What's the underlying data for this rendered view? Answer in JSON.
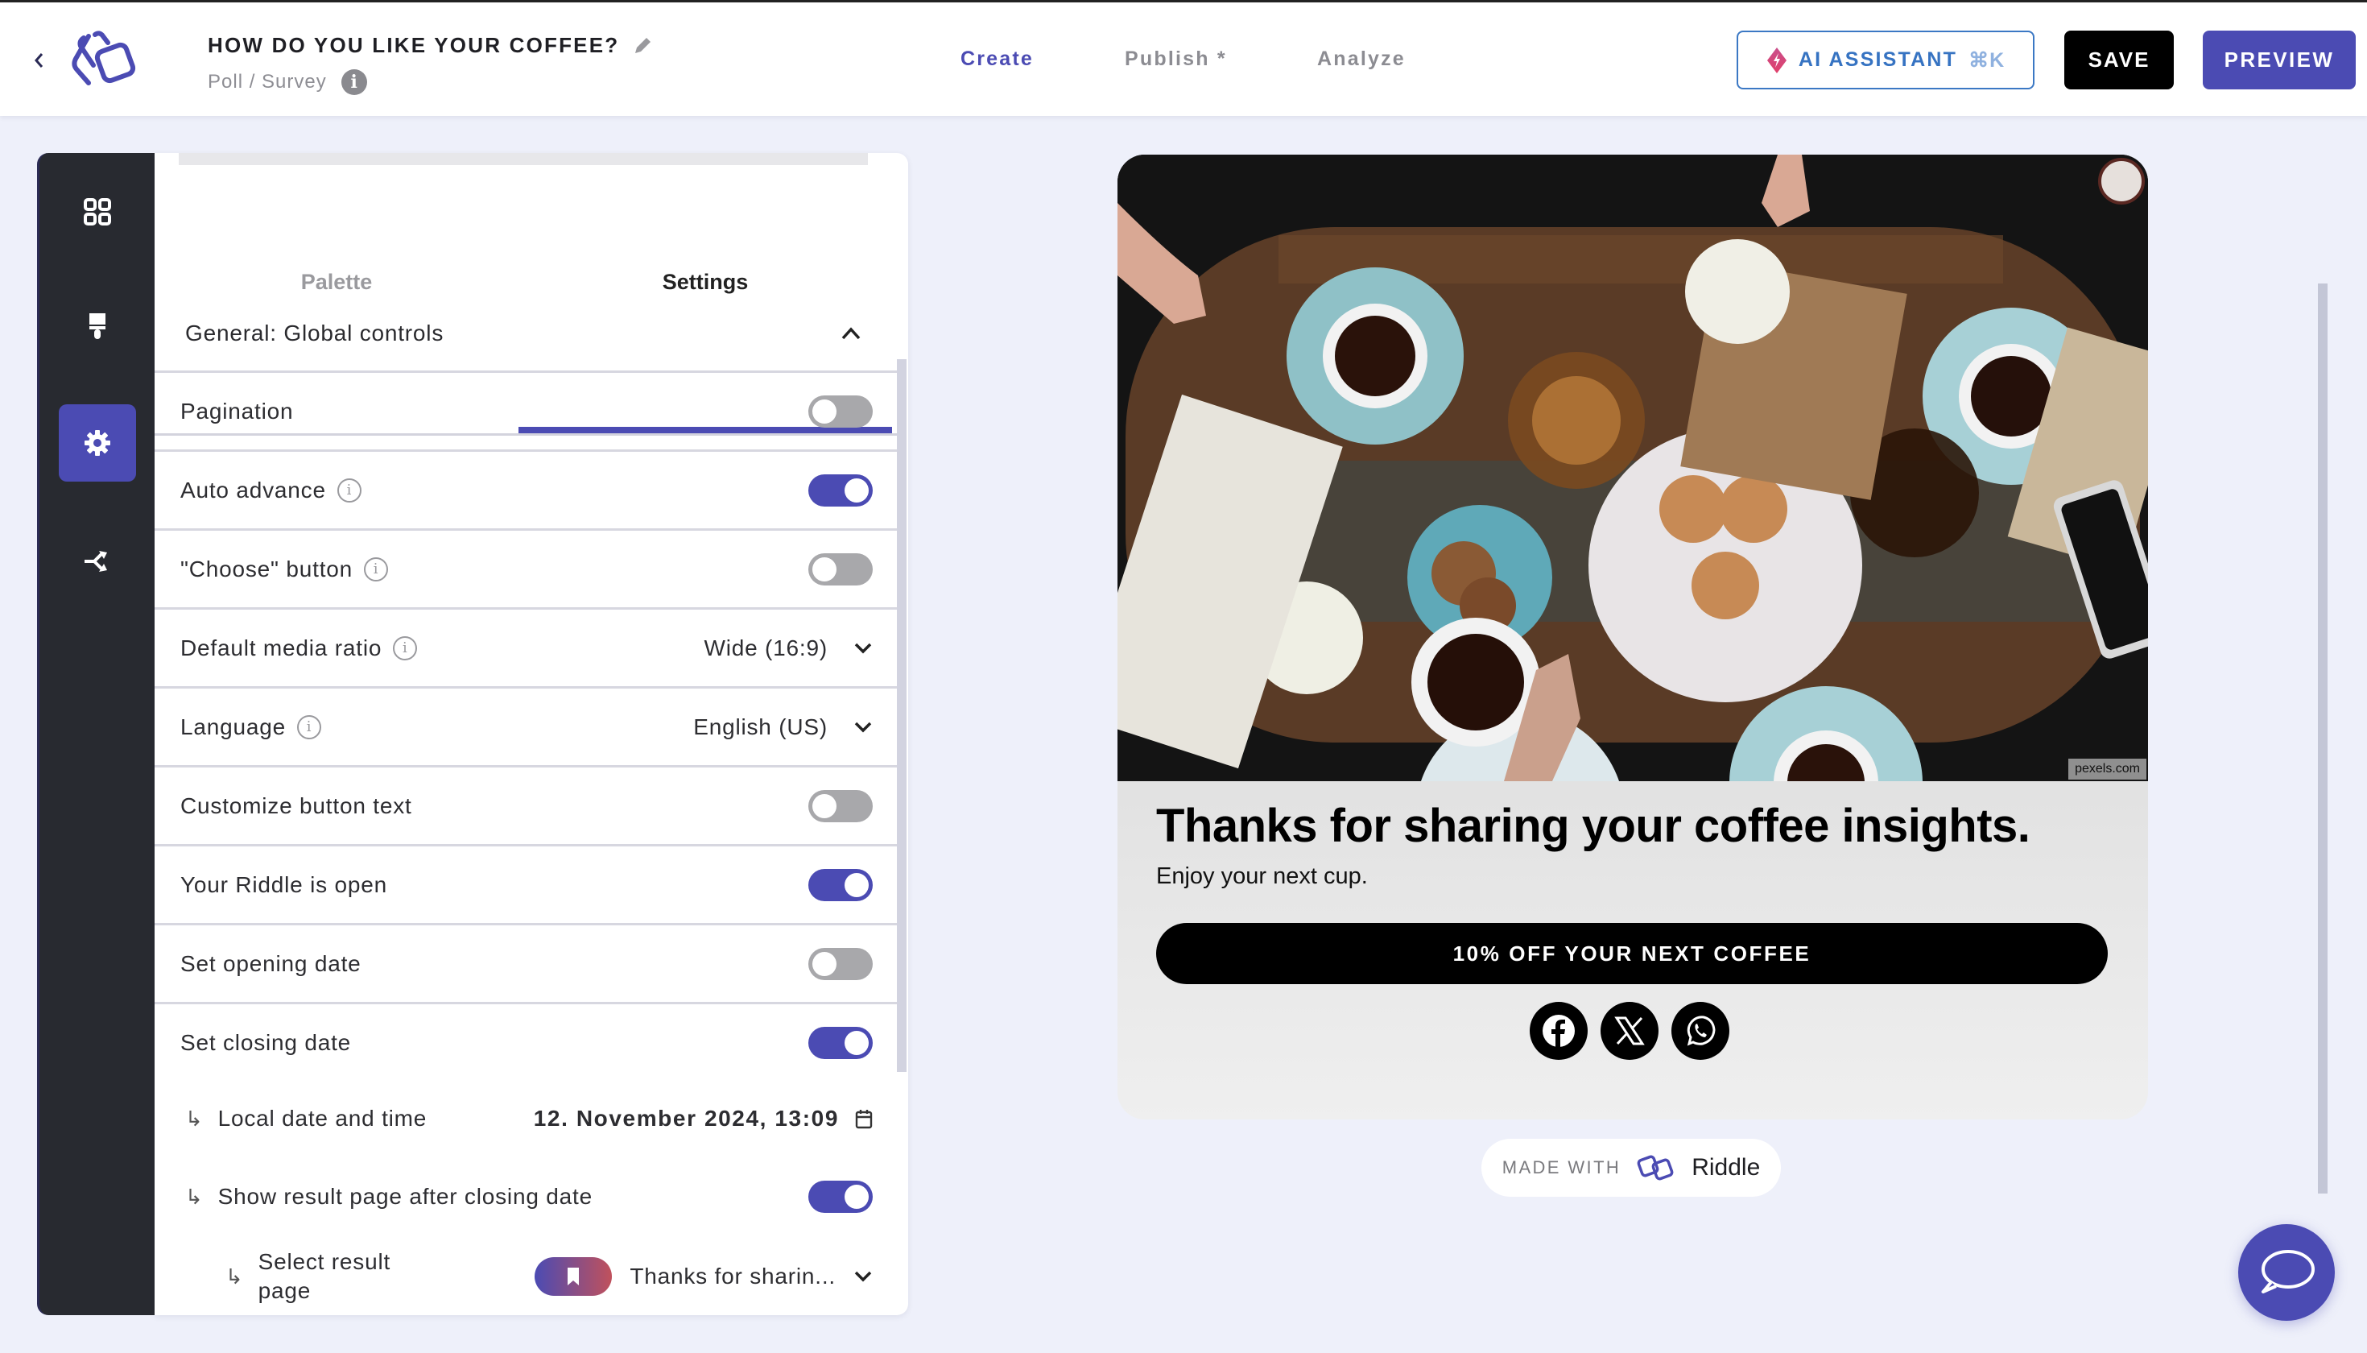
{
  "header": {
    "back_icon": "chevron-left-icon",
    "logo": "riddle-logo",
    "title": "HOW DO YOU LIKE YOUR COFFEE?",
    "edit_icon": "pencil-icon",
    "subtitle": "Poll / Survey",
    "info_icon": "info-icon",
    "nav": [
      {
        "label": "Create",
        "active": true
      },
      {
        "label": "Publish *",
        "active": false
      },
      {
        "label": "Analyze",
        "active": false
      }
    ],
    "ai_assistant": {
      "label": "AI ASSISTANT",
      "shortcut": "⌘K",
      "icon": "sparkle-diamond-icon"
    },
    "save_label": "SAVE",
    "preview_label": "PREVIEW"
  },
  "sidebar": {
    "items": [
      {
        "name": "blocks",
        "icon": "grid-icon",
        "active": false
      },
      {
        "name": "design",
        "icon": "paintbrush-icon",
        "active": false
      },
      {
        "name": "settings",
        "icon": "gear-icon",
        "active": true
      },
      {
        "name": "logic",
        "icon": "branch-icon",
        "active": false
      }
    ]
  },
  "panel": {
    "tabs": [
      {
        "label": "Palette",
        "active": false
      },
      {
        "label": "Settings",
        "active": true
      }
    ],
    "section": {
      "title": "General: Global controls",
      "expanded": true
    },
    "rows": {
      "pagination": {
        "label": "Pagination",
        "on": false
      },
      "auto_advance": {
        "label": "Auto advance",
        "on": true
      },
      "choose_button": {
        "label": "\"Choose\" button",
        "on": false
      },
      "media_ratio": {
        "label": "Default media ratio",
        "value": "Wide (16:9)"
      },
      "language": {
        "label": "Language",
        "value": "English (US)"
      },
      "customize_button_text": {
        "label": "Customize button text",
        "on": false
      },
      "riddle_open": {
        "label": "Your Riddle is open",
        "on": true
      },
      "opening_date": {
        "label": "Set opening date",
        "on": false
      },
      "closing_date": {
        "label": "Set closing date",
        "on": true
      },
      "local_datetime": {
        "label": "Local date and time",
        "value": "12. November 2024, 13:09"
      },
      "show_result": {
        "label": "Show result page after closing date",
        "on": true
      },
      "select_result": {
        "label_line1": "Select result",
        "label_line2": "page",
        "value": "Thanks for sharin..."
      }
    },
    "sub_arrow": "↳"
  },
  "preview": {
    "image_credit": "pexels.com",
    "title": "Thanks for sharing your coffee insights.",
    "subtitle": "Enjoy your next cup.",
    "cta": "10% OFF YOUR NEXT COFFEE",
    "socials": [
      "facebook-icon",
      "x-icon",
      "whatsapp-icon"
    ],
    "made_with": "MADE WITH",
    "brand": "Riddle"
  },
  "colors": {
    "accent": "#4b4bb3",
    "ai_blue": "#3673c2",
    "sidebar_bg": "#282a30",
    "toggle_off": "#a8a8ab",
    "page_bg": "#eef0fa"
  }
}
